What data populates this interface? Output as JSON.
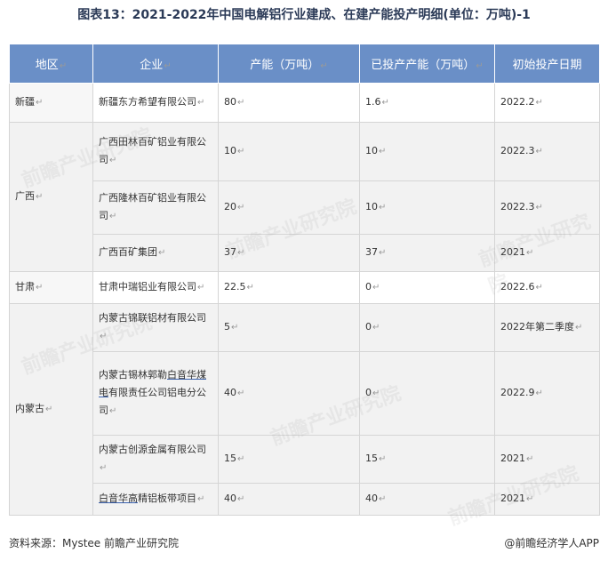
{
  "title": "图表13：2021-2022年中国电解铝行业建成、在建产能投产明细(单位：万吨)-1",
  "headers": [
    "地区",
    "企业",
    "产能（万吨）",
    "已投产产能（万吨）",
    "初始投产日期"
  ],
  "rows": [
    {
      "region": "新疆",
      "company": "新疆东方希望有限公司",
      "capacity": "80",
      "produced": "1.6",
      "date": "2022.2"
    },
    {
      "region": "广西",
      "company": "广西田林百矿铝业有限公司",
      "capacity": "10",
      "produced": "10",
      "date": "2022.3"
    },
    {
      "region": "",
      "company": "广西隆林百矿铝业有限公司",
      "capacity": "20",
      "produced": "10",
      "date": "2022.3"
    },
    {
      "region": "",
      "company": "广西百矿集团",
      "capacity": "37",
      "produced": "37",
      "date": "2021"
    },
    {
      "region": "甘肃",
      "company": "甘肃中瑞铝业有限公司",
      "capacity": "22.5",
      "produced": "0",
      "date": "2022.6"
    },
    {
      "region": "内蒙古",
      "company": "内蒙古锦联铝材有限公司",
      "capacity": "5",
      "produced": "0",
      "date": "2022年第二季度"
    },
    {
      "region": "",
      "company_pre": "内蒙古锡林郭勒",
      "company_ul": "白音华煤电",
      "company_post": "有限责任公司铝电分公司",
      "capacity": "40",
      "produced": "0",
      "date": "2022.9"
    },
    {
      "region": "",
      "company": "内蒙古创源金属有限公司",
      "capacity": "15",
      "produced": "15",
      "date": "2021"
    },
    {
      "region": "",
      "company_ul": "白音华高",
      "company_post": "精铝板带项目",
      "capacity": "40",
      "produced": "40",
      "date": "2021"
    }
  ],
  "footer": {
    "source": "资料来源：Mystee 前瞻产业研究院",
    "brand": "@前瞻经济学人APP"
  },
  "watermark": "前瞻产业研究院"
}
